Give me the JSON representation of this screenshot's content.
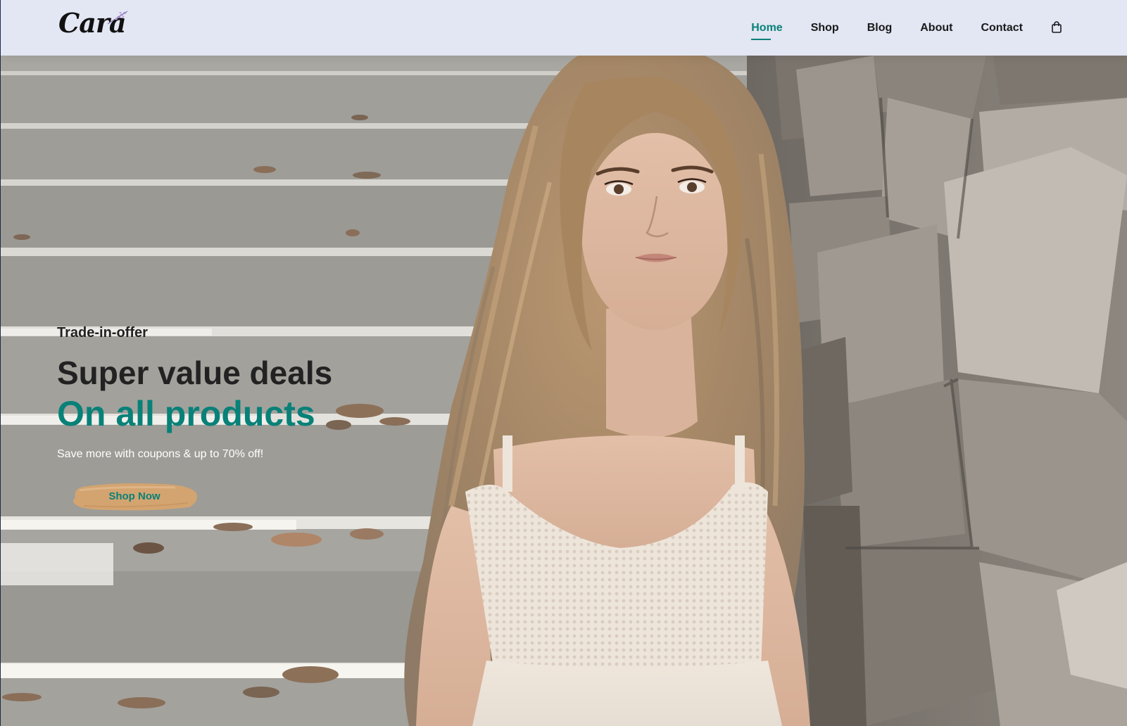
{
  "header": {
    "logo_text": "Cara",
    "nav": [
      {
        "label": "Home",
        "active": true
      },
      {
        "label": "Shop",
        "active": false
      },
      {
        "label": "Blog",
        "active": false
      },
      {
        "label": "About",
        "active": false
      },
      {
        "label": "Contact",
        "active": false
      }
    ],
    "cart_icon": "shopping-bag-icon"
  },
  "hero": {
    "tag": "Trade-in-offer",
    "heading": "Super value deals",
    "highlight": "On all products",
    "subtext": "Save more with coupons & up to 70% off!",
    "button_label": "Shop Now"
  },
  "colors": {
    "accent": "#088178",
    "header_bg": "#e3e6f3",
    "heading": "#222222",
    "button_brush": "#d9a56b"
  }
}
